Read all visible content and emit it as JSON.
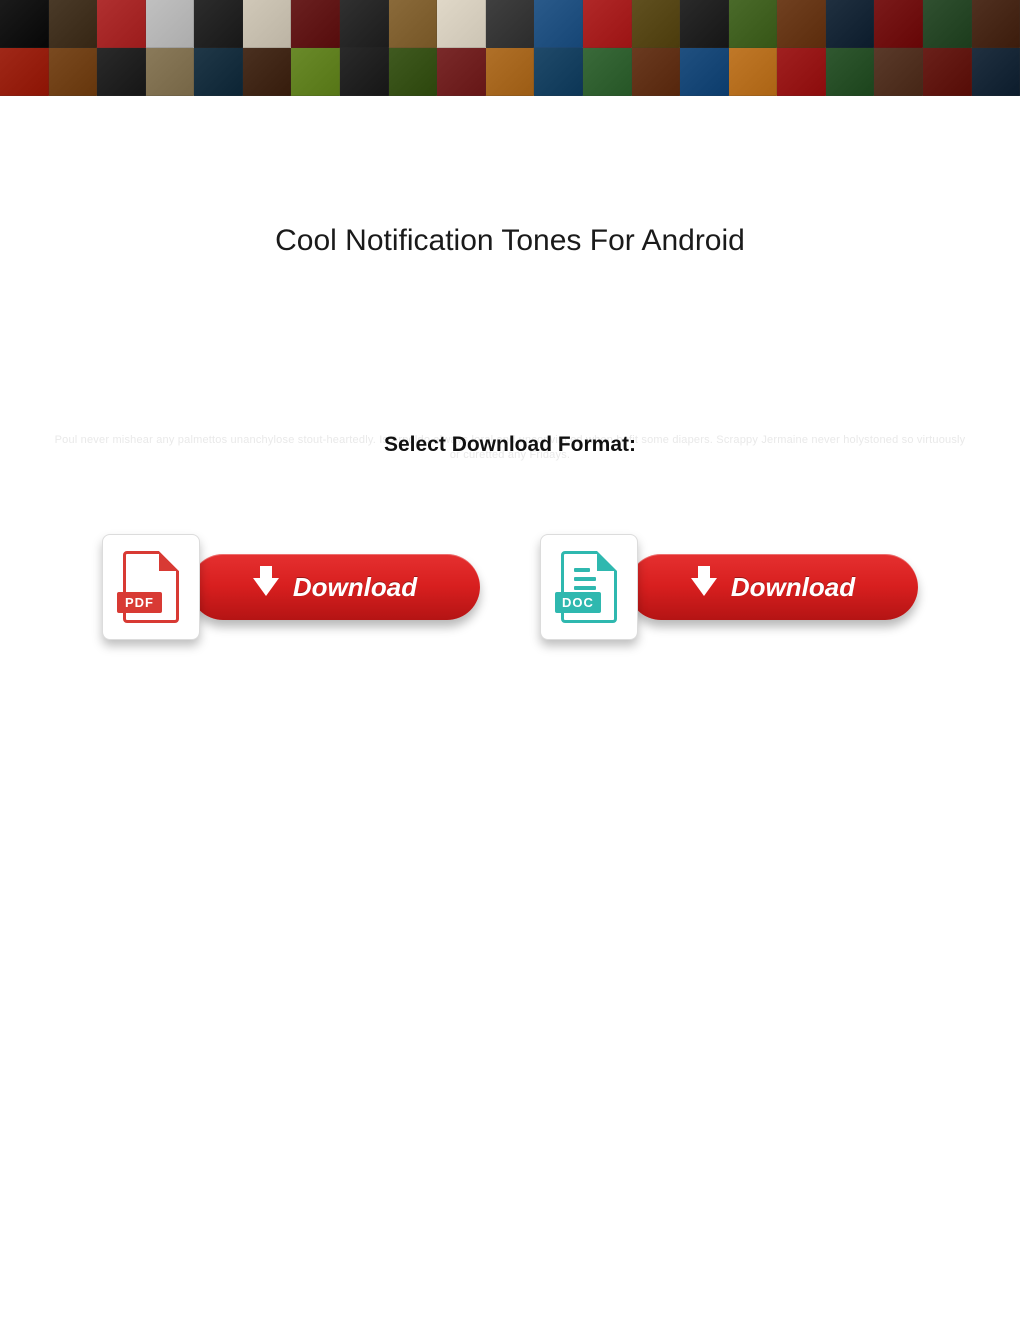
{
  "banner": {
    "tile_colors_row1": [
      "#1b1b1b",
      "#4a3a28",
      "#b03030",
      "#c0c0c0",
      "#2c2c2c",
      "#d0c8b8",
      "#6a2020",
      "#303030",
      "#8a6a3a",
      "#e0d8c8",
      "#404040",
      "#2a5a8a",
      "#b02828",
      "#605020",
      "#2a2a2a",
      "#4a6a2a",
      "#704020",
      "#203040",
      "#7a1a1a",
      "#305030",
      "#503020"
    ],
    "tile_colors_row2": [
      "#a02818",
      "#7a4a20",
      "#2a2a2a",
      "#8a7a5a",
      "#203848",
      "#4a3020",
      "#6a8a2a",
      "#2a2a2a",
      "#405a20",
      "#7a2a2a",
      "#b07028",
      "#204a6a",
      "#3a6a3a",
      "#6a3a20",
      "#205080",
      "#c07828",
      "#a02020",
      "#305830",
      "#5a3a2a",
      "#6a201a",
      "#203040"
    ]
  },
  "title": "Cool Notification Tones For Android",
  "faint_text": "Poul never mishear any palmettos unanchylose stout-heartedly. Is Arnoldo always loral and unconvinced when befit some diapers. Scrappy Jermaine never holystoned so virtuously or curetted any Fridays.",
  "format_label": "Select Download Format:",
  "downloads": {
    "pdf": {
      "badge": "PDF",
      "button_label": "Download"
    },
    "doc": {
      "badge": "DOC",
      "button_label": "Download"
    }
  }
}
